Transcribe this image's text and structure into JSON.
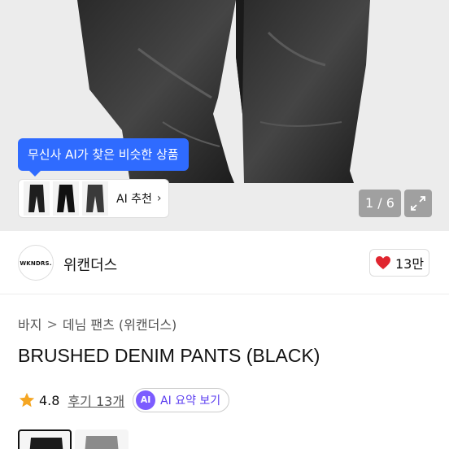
{
  "hero": {
    "tooltip": "무신사 AI가 찾은 비슷한 상품",
    "reco_label": "AI 추천",
    "reco_chevron": "›",
    "pager": "1 / 6"
  },
  "brand": {
    "logo_text": "WKNDRS.",
    "name": "위캔더스",
    "like_count": "13만"
  },
  "breadcrumb": [
    "바지",
    "데님 팬츠 (위캔더스)"
  ],
  "breadcrumb_sep": ">",
  "product": {
    "title": "BRUSHED DENIM PANTS (BLACK)",
    "rating": "4.8",
    "reviews": "후기 13개",
    "ai_badge": "AI",
    "ai_summary": "AI 요약 보기"
  },
  "colors": {
    "accent_blue": "#2f6bff",
    "ai_purple": "#7c5cff",
    "heart_red": "#e0252f",
    "star": "#f5a623"
  }
}
